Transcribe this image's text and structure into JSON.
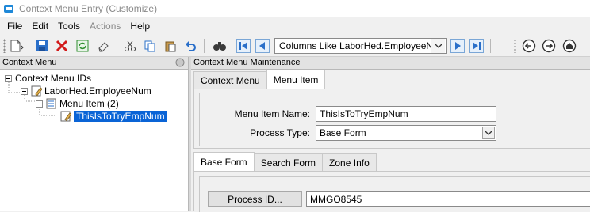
{
  "window": {
    "title": "Context Menu Entry (Customize)"
  },
  "menubar": {
    "items": [
      "File",
      "Edit",
      "Tools",
      "Actions",
      "Help"
    ]
  },
  "toolbar": {
    "combo_value": "Columns Like LaborHed.EmployeeNum"
  },
  "left_panel": {
    "header": "Context Menu",
    "tree": {
      "root": "Context Menu IDs",
      "child": "LaborHed.EmployeeNum",
      "grandchild": "Menu Item (2)",
      "leaf": "ThisIsToTryEmpNum"
    }
  },
  "right_panel": {
    "header": "Context Menu Maintenance",
    "tabs": [
      "Context Menu",
      "Menu Item"
    ],
    "form": {
      "menu_item_name_label": "Menu Item Name:",
      "menu_item_name_value": "ThisIsToTryEmpNum",
      "process_type_label": "Process Type:",
      "process_type_value": "Base Form"
    },
    "subtabs": [
      "Base Form",
      "Search Form",
      "Zone Info"
    ],
    "base_form": {
      "process_id_button": "Process ID...",
      "process_id_value": "MMGO8545"
    }
  },
  "colors": {
    "selection": "#0a64d6",
    "app_icon": "#1e88d8",
    "delete_red": "#d21a1a"
  }
}
